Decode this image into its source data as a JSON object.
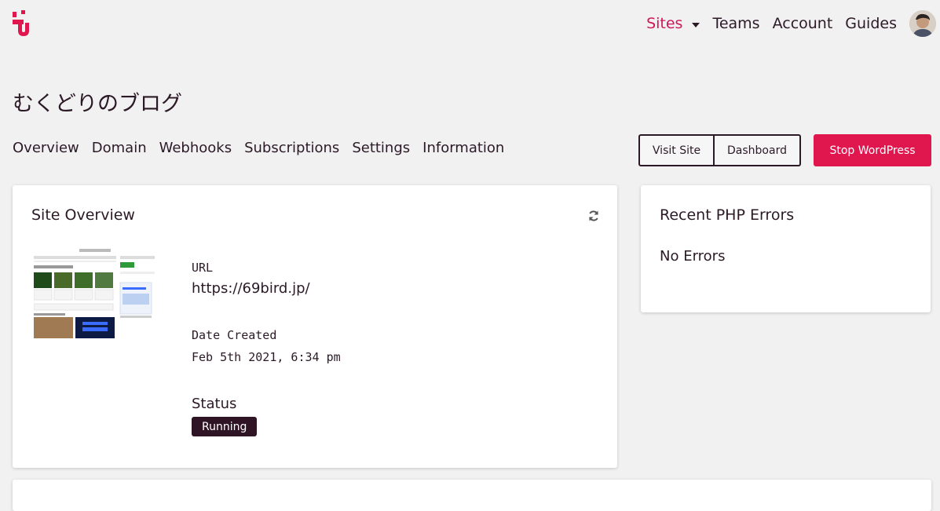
{
  "nav": {
    "items": [
      {
        "label": "Sites",
        "active": true
      },
      {
        "label": "Teams"
      },
      {
        "label": "Account"
      },
      {
        "label": "Guides"
      }
    ]
  },
  "site": {
    "title": "むくどりのブログ"
  },
  "tabs": [
    "Overview",
    "Domain",
    "Webhooks",
    "Subscriptions",
    "Settings",
    "Information"
  ],
  "actions": {
    "visit_site": "Visit Site",
    "dashboard": "Dashboard",
    "stop_wordpress": "Stop WordPress"
  },
  "overview": {
    "title": "Site Overview",
    "url_label": "URL",
    "url_value": "https://69bird.jp/",
    "date_label": "Date Created",
    "date_value": "Feb 5th 2021, 6:34 pm",
    "status_label": "Status",
    "status_value": "Running"
  },
  "errors": {
    "title": "Recent PHP Errors",
    "message": "No Errors"
  },
  "colors": {
    "accent": "#e0164f",
    "nav_active": "#d0175a",
    "text": "#2b1a26",
    "badge": "#2f1425",
    "background": "#f2f1f2"
  }
}
